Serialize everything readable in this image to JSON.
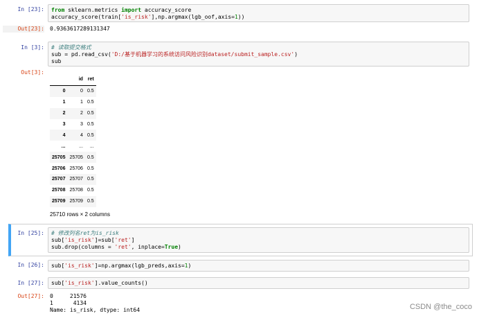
{
  "cells": [
    {
      "prompt": "In  [23]:",
      "lines": [
        [
          {
            "t": "from",
            "c": "kw"
          },
          {
            "t": " sklearn.metrics "
          },
          {
            "t": "import",
            "c": "kw"
          },
          {
            "t": " accuracy_score"
          }
        ],
        [
          {
            "t": "accuracy_score(train["
          },
          {
            "t": "'is_risk'",
            "c": "str"
          },
          {
            "t": "],np.argmax(lgb_oof,axis="
          },
          {
            "t": "1",
            "c": "num"
          },
          {
            "t": "))"
          }
        ]
      ],
      "out_prompt": "Out[23]:",
      "output": "0.9363617289131347"
    },
    {
      "prompt": "In  [3]:",
      "lines": [
        [
          {
            "t": "# 读取提交格式",
            "c": "comment"
          }
        ],
        [
          {
            "t": "sub = pd.read_csv("
          },
          {
            "t": "'D:/基于机器学习的系统访问风险识别dataset/submit_sample.csv'",
            "c": "str"
          },
          {
            "t": ")"
          }
        ],
        [
          {
            "t": "sub"
          }
        ]
      ],
      "out_prompt": "Out[3]:"
    },
    {
      "prompt": "In  [25]:",
      "lines": [
        [
          {
            "t": "# 修改列名ret为is_risk",
            "c": "comment"
          }
        ],
        [
          {
            "t": "sub["
          },
          {
            "t": "'is_risk'",
            "c": "str"
          },
          {
            "t": "]=sub["
          },
          {
            "t": "'ret'",
            "c": "str"
          },
          {
            "t": "]"
          }
        ],
        [
          {
            "t": "sub.drop(columns = "
          },
          {
            "t": "'ret'",
            "c": "str"
          },
          {
            "t": ", inplace="
          },
          {
            "t": "True",
            "c": "kw"
          },
          {
            "t": ")"
          }
        ]
      ]
    },
    {
      "prompt": "In  [26]:",
      "lines": [
        [
          {
            "t": "sub["
          },
          {
            "t": "'is_risk'",
            "c": "str"
          },
          {
            "t": "]=np.argmax(lgb_preds,axis="
          },
          {
            "t": "1",
            "c": "num"
          },
          {
            "t": ")"
          }
        ]
      ]
    },
    {
      "prompt": "In  [27]:",
      "lines": [
        [
          {
            "t": "sub["
          },
          {
            "t": "'is_risk'",
            "c": "str"
          },
          {
            "t": "].value_counts()"
          }
        ]
      ],
      "out_prompt": "Out[27]:",
      "output_lines": [
        "0     21576",
        "1      4134",
        "Name: is_risk, dtype: int64"
      ]
    }
  ],
  "dataframe": {
    "columns": [
      "",
      "id",
      "ret"
    ],
    "rows": [
      [
        "0",
        "0",
        "0.5"
      ],
      [
        "1",
        "1",
        "0.5"
      ],
      [
        "2",
        "2",
        "0.5"
      ],
      [
        "3",
        "3",
        "0.5"
      ],
      [
        "4",
        "4",
        "0.5"
      ],
      [
        "...",
        "...",
        "..."
      ],
      [
        "25705",
        "25705",
        "0.5"
      ],
      [
        "25706",
        "25706",
        "0.5"
      ],
      [
        "25707",
        "25707",
        "0.5"
      ],
      [
        "25708",
        "25708",
        "0.5"
      ],
      [
        "25709",
        "25709",
        "0.5"
      ]
    ],
    "shape": "25710 rows × 2 columns"
  },
  "watermark": "CSDN @the_coco",
  "colors": {
    "in_prompt": "#303f9f",
    "out_prompt": "#d84315",
    "selected_border": "#42a5f5"
  }
}
